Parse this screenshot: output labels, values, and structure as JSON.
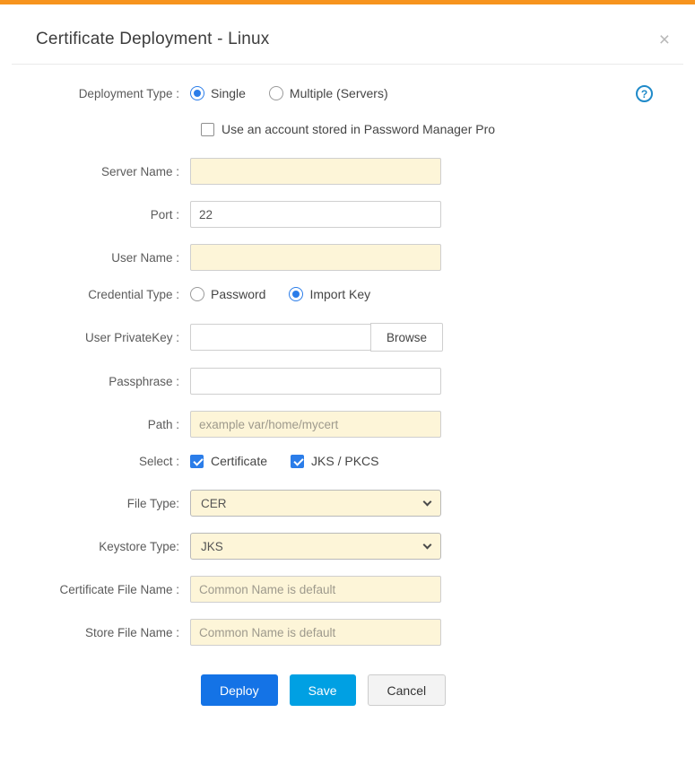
{
  "dialog": {
    "title": "Certificate Deployment - Linux",
    "close_icon": "×"
  },
  "form": {
    "deployment_type": {
      "label": "Deployment Type :",
      "options": [
        {
          "label": "Single",
          "selected": true
        },
        {
          "label": "Multiple (Servers)",
          "selected": false
        }
      ],
      "help_icon": "?"
    },
    "pmp_checkbox": {
      "label": "Use an account stored in Password Manager Pro",
      "checked": false
    },
    "server_name": {
      "label": "Server Name :",
      "value": ""
    },
    "port": {
      "label": "Port :",
      "value": "22"
    },
    "user_name": {
      "label": "User Name :",
      "value": ""
    },
    "credential_type": {
      "label": "Credential Type :",
      "options": [
        {
          "label": "Password",
          "selected": false
        },
        {
          "label": "Import Key",
          "selected": true
        }
      ]
    },
    "user_private_key": {
      "label": "User PrivateKey :",
      "value": "",
      "browse_label": "Browse"
    },
    "passphrase": {
      "label": "Passphrase :",
      "value": ""
    },
    "path": {
      "label": "Path :",
      "placeholder": "example var/home/mycert"
    },
    "select_row": {
      "label": "Select :",
      "options": [
        {
          "label": "Certificate",
          "checked": true
        },
        {
          "label": "JKS / PKCS",
          "checked": true
        }
      ]
    },
    "file_type": {
      "label": "File Type:",
      "value": "CER"
    },
    "keystore_type": {
      "label": "Keystore Type:",
      "value": "JKS"
    },
    "certificate_file_name": {
      "label": "Certificate File Name :",
      "placeholder": "Common Name is default"
    },
    "store_file_name": {
      "label": "Store File Name :",
      "placeholder": "Common Name is default"
    },
    "buttons": {
      "deploy": "Deploy",
      "save": "Save",
      "cancel": "Cancel"
    }
  },
  "colors": {
    "accent_orange": "#f7941e",
    "primary_blue": "#1473e6",
    "save_blue": "#00a0e3",
    "selection_blue": "#2b7de9",
    "input_cream": "#fdf5d8"
  }
}
